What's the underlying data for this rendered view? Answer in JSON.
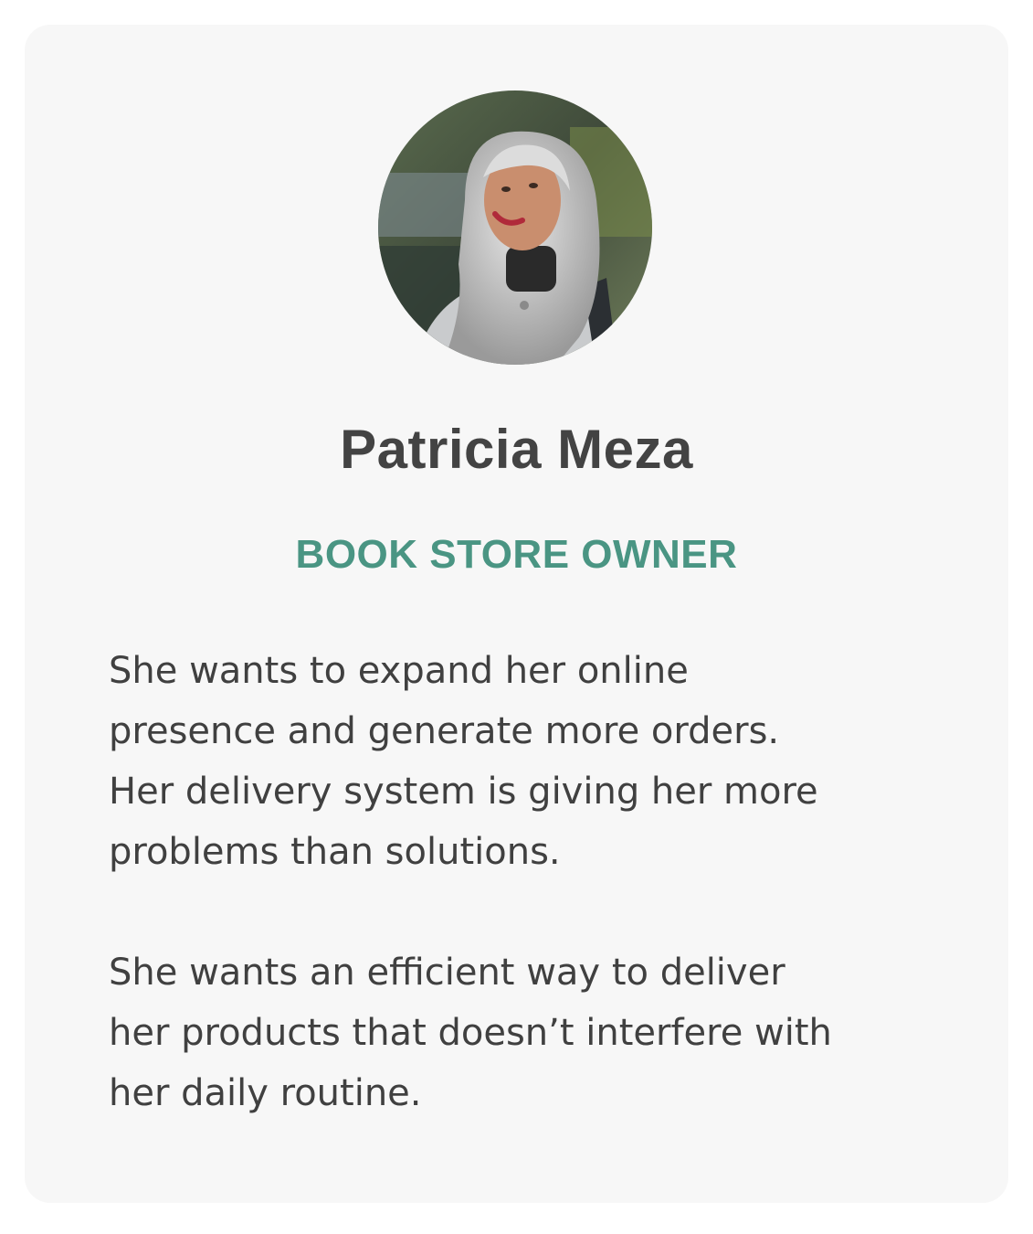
{
  "persona": {
    "name": "Patricia Meza",
    "role": "BOOK STORE OWNER",
    "paragraph_1": [
      "She wants to expand her online",
      "presence and generate more orders.",
      "Her delivery system is giving her more",
      "problems than solutions."
    ],
    "paragraph_2": [
      "She wants an efficient way to deliver",
      "her products that doesn’t interfere with",
      "her daily routine."
    ]
  },
  "colors": {
    "card_background": "#f7f7f7",
    "name_text": "#434343",
    "role_accent": "#4a9583",
    "body_text": "#404040"
  }
}
